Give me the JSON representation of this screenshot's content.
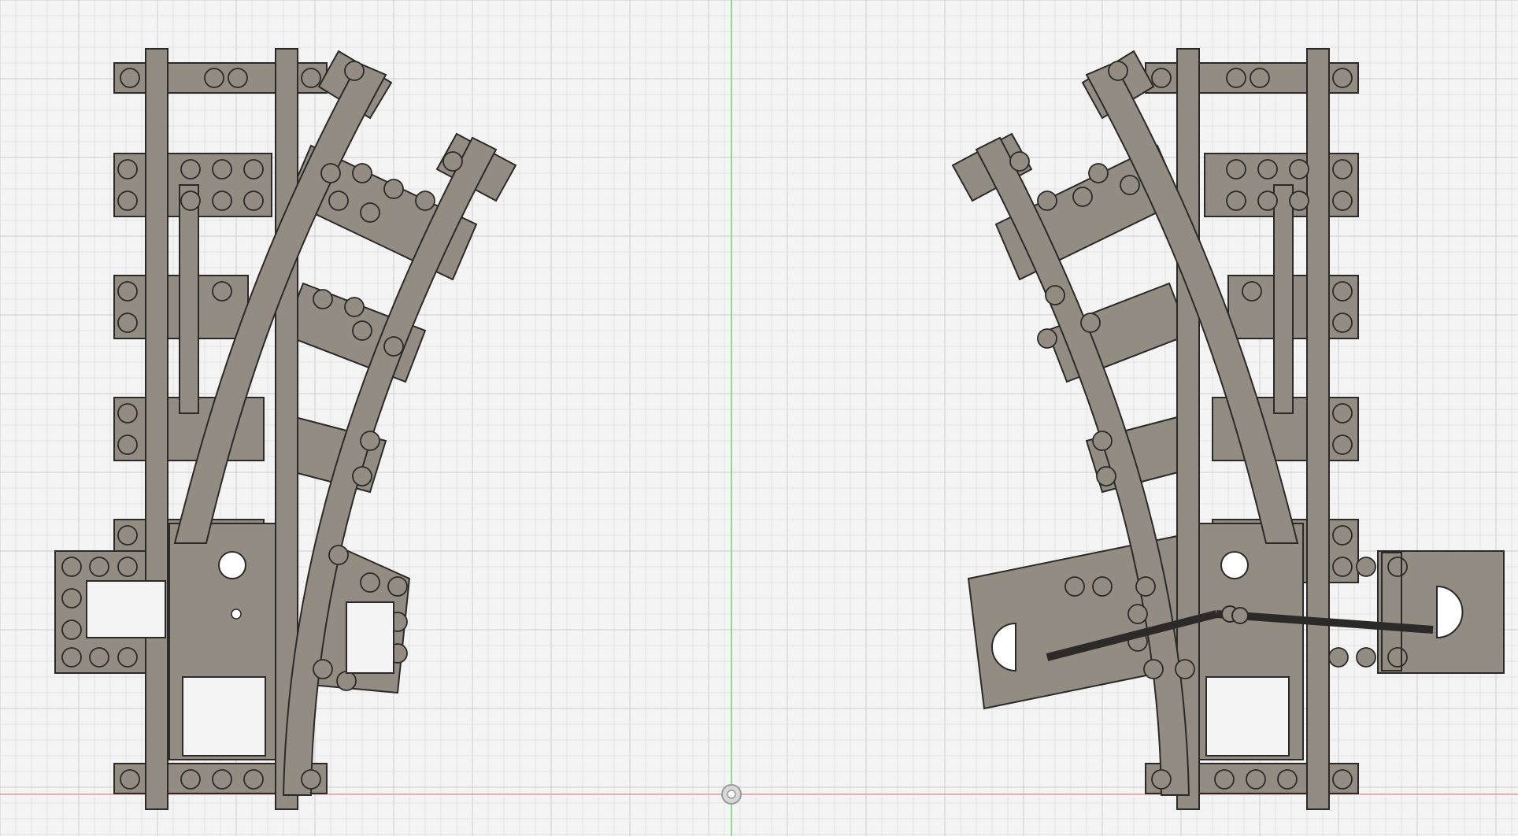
{
  "viewport": {
    "name": "cad-sketch-viewport",
    "background": "#f4f4f4",
    "grid_minor_color": "#e3e3e3",
    "grid_major_color": "#cdcdcd",
    "axis_vertical_color": "#8fd88f",
    "axis_horizontal_color": "#e59a9a"
  },
  "parts": [
    {
      "name": "left-track-switch",
      "variant": "left",
      "fill": "#928c82",
      "stroke": "#2b2a28"
    },
    {
      "name": "right-track-switch",
      "variant": "right",
      "fill": "#928c82",
      "stroke": "#2b2a28"
    }
  ],
  "origin_marker": {
    "name": "origin-marker-icon",
    "color": "#9a9a9a"
  }
}
